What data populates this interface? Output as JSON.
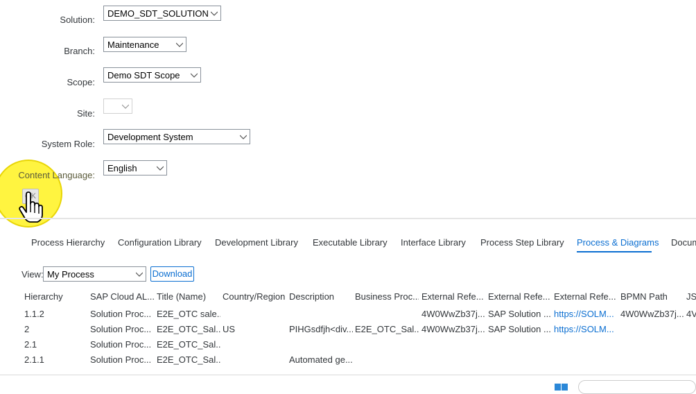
{
  "form": {
    "solution": {
      "label": "Solution:",
      "value": "DEMO_SDT_SOLUTION"
    },
    "branch": {
      "label": "Branch:",
      "value": "Maintenance"
    },
    "scope": {
      "label": "Scope:",
      "value": "Demo SDT Scope"
    },
    "site": {
      "label": "Site:",
      "value": ""
    },
    "system_role": {
      "label": "System Role:",
      "value": "Development System"
    },
    "content_language": {
      "label": "Content Language:",
      "value": "English"
    },
    "ok_label": "OK"
  },
  "tabs": [
    {
      "label": "Process Hierarchy",
      "active": false
    },
    {
      "label": "Configuration Library",
      "active": false
    },
    {
      "label": "Development Library",
      "active": false
    },
    {
      "label": "Executable Library",
      "active": false
    },
    {
      "label": "Interface Library",
      "active": false
    },
    {
      "label": "Process Step Library",
      "active": false
    },
    {
      "label": "Process & Diagrams",
      "active": true
    },
    {
      "label": "Docum",
      "active": false
    }
  ],
  "view": {
    "label": "View:",
    "value": "My Process",
    "download_label": "Download"
  },
  "table": {
    "headers": [
      "Hierarchy",
      "SAP Cloud AL...",
      "Title (Name)",
      "Country/Region",
      "Description",
      "Business Proc...",
      "External Refe...",
      "External Refe...",
      "External Refe...",
      "BPMN Path",
      "JS"
    ],
    "rows": [
      [
        "1.1.2",
        "Solution Proc...",
        "E2E_OTC sale...",
        "",
        "",
        "",
        "4W0WwZb37j...",
        "SAP Solution ...",
        "https://SOLM...",
        "4W0WwZb37j...",
        "4V"
      ],
      [
        "2",
        "Solution Proc...",
        "E2E_OTC_Sal...",
        "US",
        "PIHGsdfjh<div...",
        "E2E_OTC_Sal...",
        "4W0WwZb37j...",
        "SAP Solution ...",
        "https://SOLM...",
        "",
        ""
      ],
      [
        "2.1",
        "Solution Proc...",
        "E2E_OTC_Sal...",
        "",
        "",
        "",
        "",
        "",
        "",
        "",
        ""
      ],
      [
        "2.1.1",
        "Solution Proc...",
        "E2E_OTC_Sal...",
        "",
        "Automated ge...",
        "",
        "",
        "",
        "",
        "",
        ""
      ]
    ]
  },
  "colors": {
    "accent": "#0a6ed1",
    "highlight": "#fff000"
  }
}
